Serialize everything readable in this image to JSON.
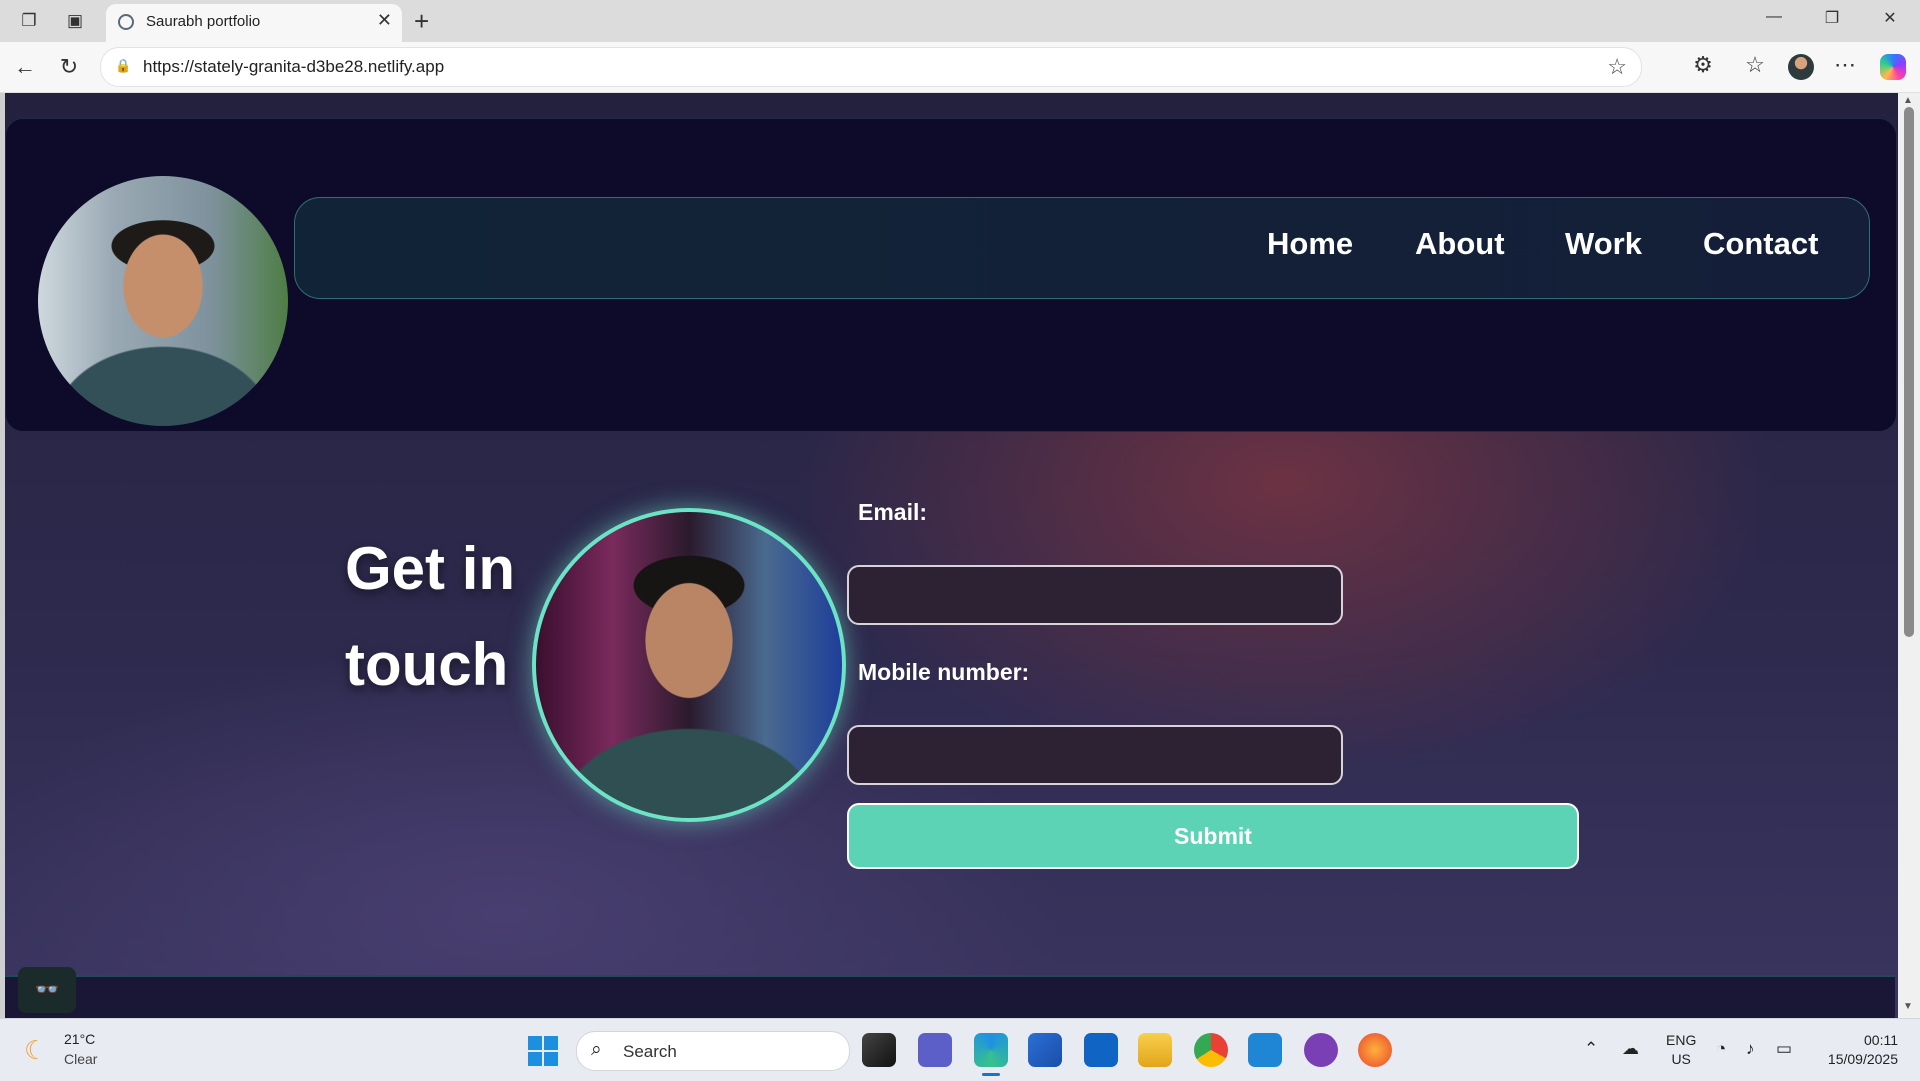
{
  "browser": {
    "tab_title": "Saurabh portfolio",
    "url": "https://stately-granita-d3be28.netlify.app",
    "tab_close": "✕",
    "new_tab": "+"
  },
  "site": {
    "nav": [
      "Home",
      "About",
      "Work",
      "Contact"
    ],
    "heading_line1": "Get in",
    "heading_line2": "touch",
    "email_label": "Email:",
    "mobile_label": "Mobile number:",
    "email_value": "",
    "mobile_value": "",
    "submit_label": "Submit",
    "accent_color": "#5dd3b6"
  },
  "taskbar": {
    "temperature": "21°C",
    "weather": "Clear",
    "search_placeholder": "Search",
    "language": "ENG",
    "region": "US",
    "time": "00:11",
    "date": "15/09/2025"
  },
  "icons": {
    "tab_actions": "tab-actions-icon",
    "vertical_tabs": "vertical-tabs-icon",
    "back": "back-arrow-icon",
    "refresh": "refresh-icon",
    "extensions": "puzzle-icon",
    "favorites": "favorites-icon",
    "more": "more-icon"
  }
}
